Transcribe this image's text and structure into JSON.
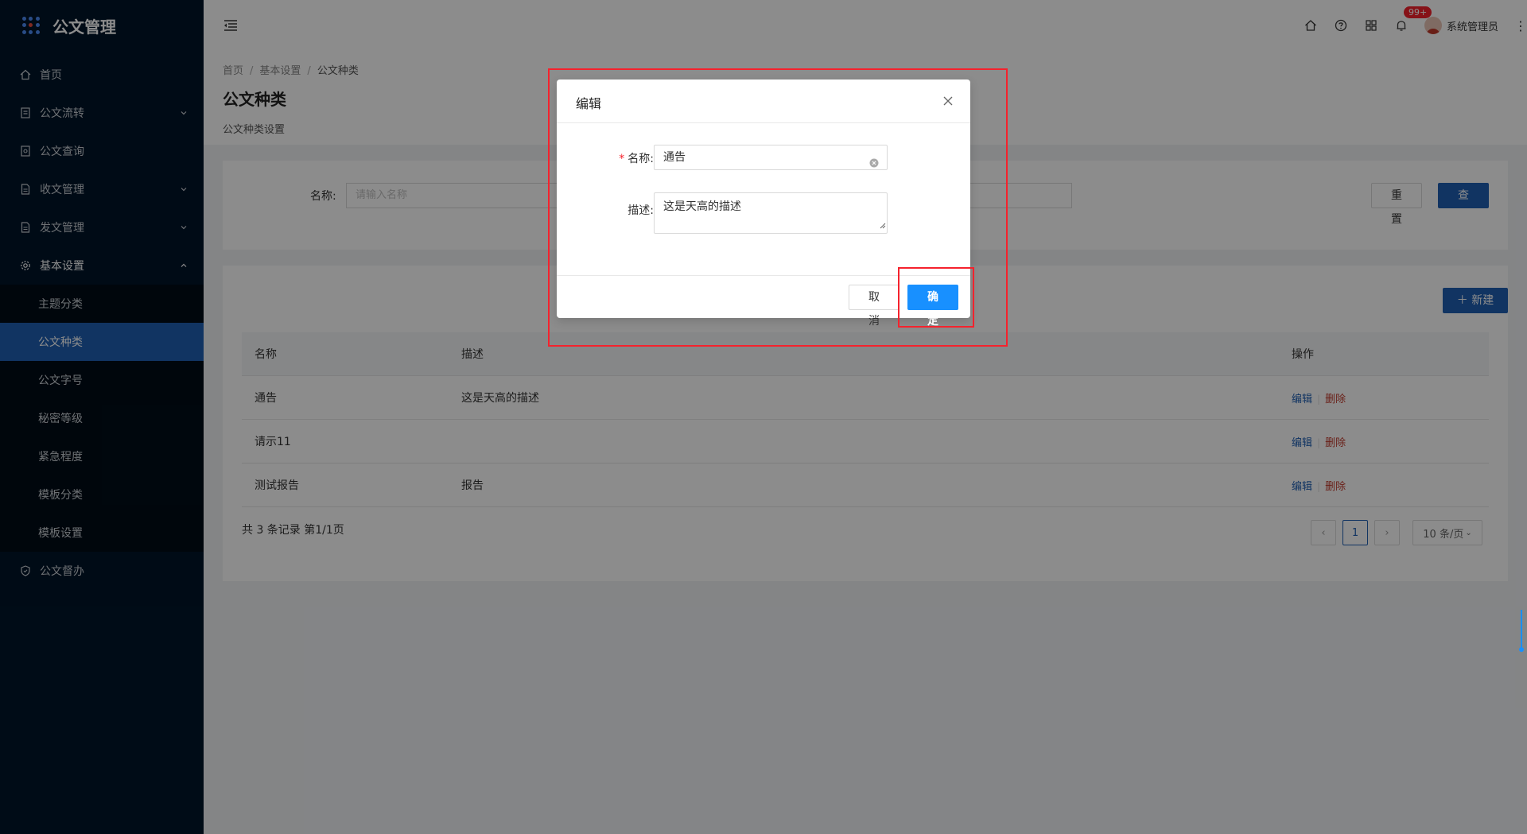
{
  "app": {
    "title": "公文管理"
  },
  "colors": {
    "sidebar_bg": "#001529",
    "primary": "#1f5fb3",
    "confirm": "#1890ff",
    "danger": "#c0392b",
    "highlight": "#f5222d"
  },
  "sidebar": {
    "items": [
      {
        "label": "首页",
        "icon": "home-icon"
      },
      {
        "label": "公文流转",
        "icon": "document-icon",
        "expandable": true
      },
      {
        "label": "公文查询",
        "icon": "document-search-icon"
      },
      {
        "label": "收文管理",
        "icon": "file-icon",
        "expandable": true
      },
      {
        "label": "发文管理",
        "icon": "file-icon",
        "expandable": true
      },
      {
        "label": "基本设置",
        "icon": "gear-icon",
        "expanded": true,
        "children": [
          "主题分类",
          "公文种类",
          "公文字号",
          "秘密等级",
          "紧急程度",
          "模板分类",
          "模板设置"
        ],
        "active_child": "公文种类"
      },
      {
        "label": "公文督办",
        "icon": "shield-icon"
      }
    ]
  },
  "header": {
    "notification_badge": "99+",
    "username": "系统管理员"
  },
  "breadcrumb": [
    "首页",
    "基本设置",
    "公文种类"
  ],
  "page": {
    "title": "公文种类",
    "subtitle": "公文种类设置"
  },
  "search": {
    "label": "名称:",
    "placeholder": "请输入名称",
    "reset": "重 置",
    "query": "查 询"
  },
  "list": {
    "new_button": "新建",
    "columns": [
      "名称",
      "描述",
      "操作"
    ],
    "rows": [
      {
        "name": "通告",
        "desc": "这是天高的描述"
      },
      {
        "name": "请示11",
        "desc": ""
      },
      {
        "name": "测试报告",
        "desc": "报告"
      }
    ],
    "edit": "编辑",
    "delete": "删除",
    "total": "共 3 条记录 第1/1页",
    "current_page": "1",
    "page_size": "10 条/页"
  },
  "modal": {
    "title": "编辑",
    "name_label": "名称:",
    "name_value": "通告",
    "desc_label": "描述:",
    "desc_value": "这是天高的描述",
    "cancel": "取 消",
    "ok": "确 定"
  }
}
